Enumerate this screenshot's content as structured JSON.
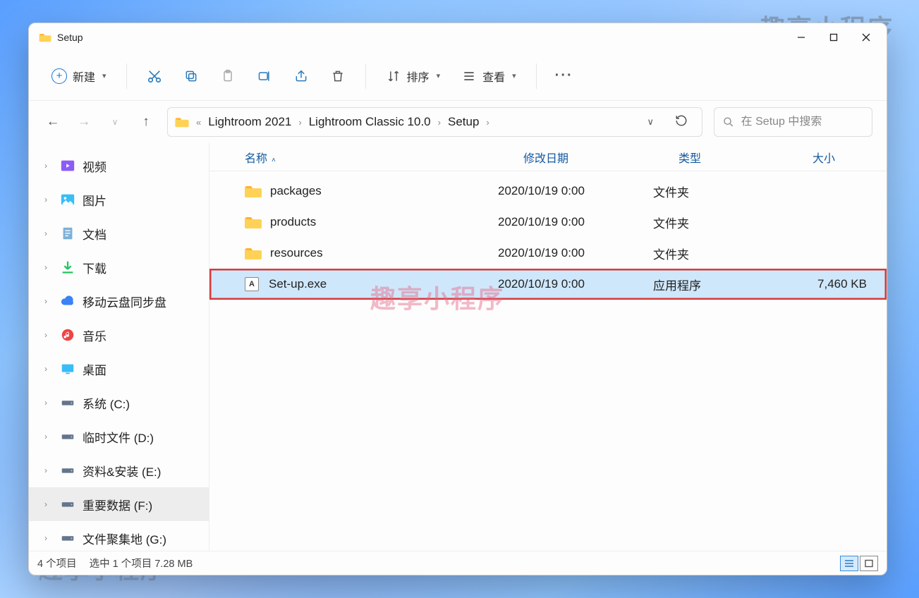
{
  "watermarks": {
    "top": "趣享小程序",
    "mid": "趣享小程序",
    "bot": "趣享小程序"
  },
  "title": "Setup",
  "toolbar": {
    "new_label": "新建",
    "sort_label": "排序",
    "view_label": "查看"
  },
  "breadcrumbs": {
    "a": "Lightroom 2021",
    "b": "Lightroom Classic 10.0",
    "c": "Setup"
  },
  "search": {
    "placeholder": "在 Setup 中搜索"
  },
  "columns": {
    "name": "名称",
    "date": "修改日期",
    "type": "类型",
    "size": "大小"
  },
  "nav": {
    "items": [
      {
        "label": "视频",
        "icon": "video"
      },
      {
        "label": "图片",
        "icon": "pictures"
      },
      {
        "label": "文档",
        "icon": "documents"
      },
      {
        "label": "下载",
        "icon": "downloads"
      },
      {
        "label": "移动云盘同步盘",
        "icon": "cloud"
      },
      {
        "label": "音乐",
        "icon": "music"
      },
      {
        "label": "桌面",
        "icon": "desktop"
      },
      {
        "label": "系统 (C:)",
        "icon": "drive"
      },
      {
        "label": "临时文件 (D:)",
        "icon": "drive"
      },
      {
        "label": "资料&安装 (E:)",
        "icon": "drive"
      },
      {
        "label": "重要数据 (F:)",
        "icon": "drive",
        "selected": true
      },
      {
        "label": "文件聚集地 (G:)",
        "icon": "drive"
      }
    ]
  },
  "files": [
    {
      "name": "packages",
      "date": "2020/10/19 0:00",
      "type": "文件夹",
      "size": "",
      "kind": "folder"
    },
    {
      "name": "products",
      "date": "2020/10/19 0:00",
      "type": "文件夹",
      "size": "",
      "kind": "folder"
    },
    {
      "name": "resources",
      "date": "2020/10/19 0:00",
      "type": "文件夹",
      "size": "",
      "kind": "folder"
    },
    {
      "name": "Set-up.exe",
      "date": "2020/10/19 0:00",
      "type": "应用程序",
      "size": "7,460 KB",
      "kind": "app",
      "selected": true,
      "highlighted": true
    }
  ],
  "status": {
    "count": "4 个项目",
    "selection": "选中 1 个项目 7.28 MB"
  }
}
